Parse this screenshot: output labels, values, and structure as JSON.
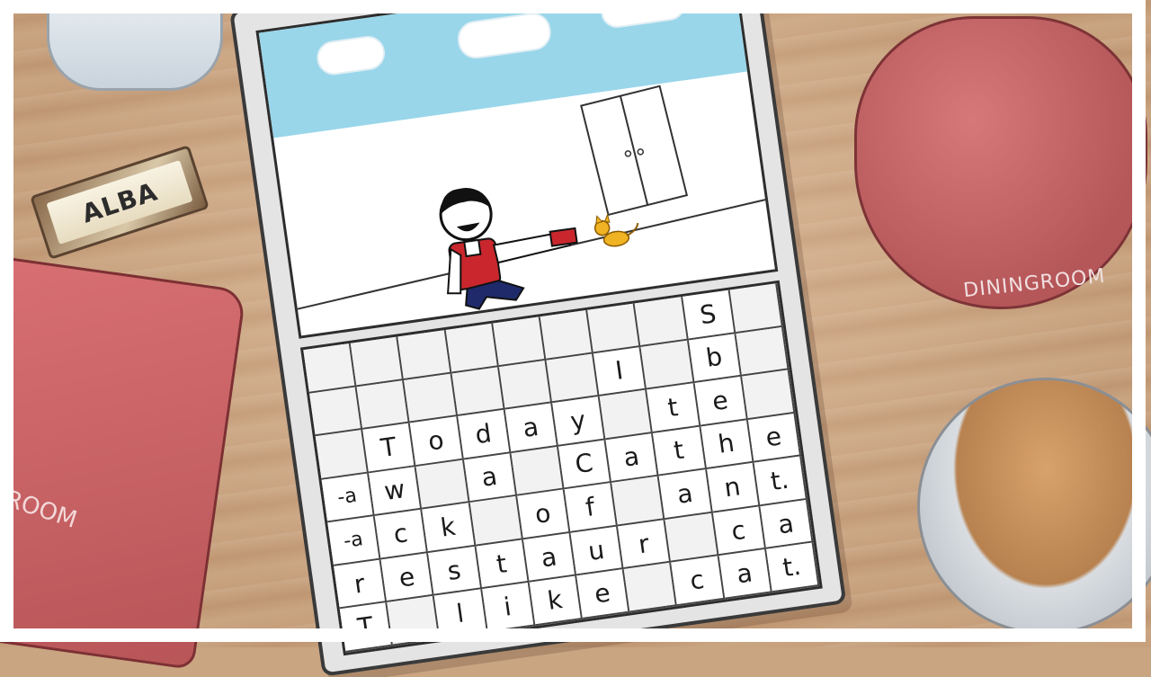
{
  "props": {
    "nametag_text": "ALBA",
    "cap_text": "DININGROOM",
    "apron_text": "ROOM"
  },
  "game": {
    "scene": {
      "character": "smiling-boy-icon",
      "pet": "cat-icon",
      "door": "double-door-icon"
    },
    "grid_rows": [
      [
        "",
        "",
        "",
        "",
        "",
        "",
        "",
        "",
        "S",
        ""
      ],
      [
        "",
        "",
        "",
        "",
        "",
        "",
        "I",
        "",
        "b",
        ""
      ],
      [
        "",
        "T",
        "o",
        "d",
        "a",
        "y",
        "",
        "t",
        "e",
        ""
      ],
      [
        "-a",
        "w",
        "",
        "a",
        "",
        "C",
        "a",
        "t",
        "h",
        "e"
      ],
      [
        "-a",
        "c",
        "k",
        "",
        "o",
        "f",
        "",
        "a",
        "n",
        "t."
      ],
      [
        "r",
        "e",
        "s",
        "t",
        "a",
        "u",
        "r",
        "",
        "c",
        "a"
      ],
      [
        "T",
        "",
        "l",
        "i",
        "k",
        "e",
        "",
        "c",
        "a",
        "t."
      ]
    ]
  },
  "colors": {
    "sky": "#99d6ea",
    "shirt": "#c9272d",
    "pants": "#1f2a6b",
    "cat": "#f0b323"
  }
}
